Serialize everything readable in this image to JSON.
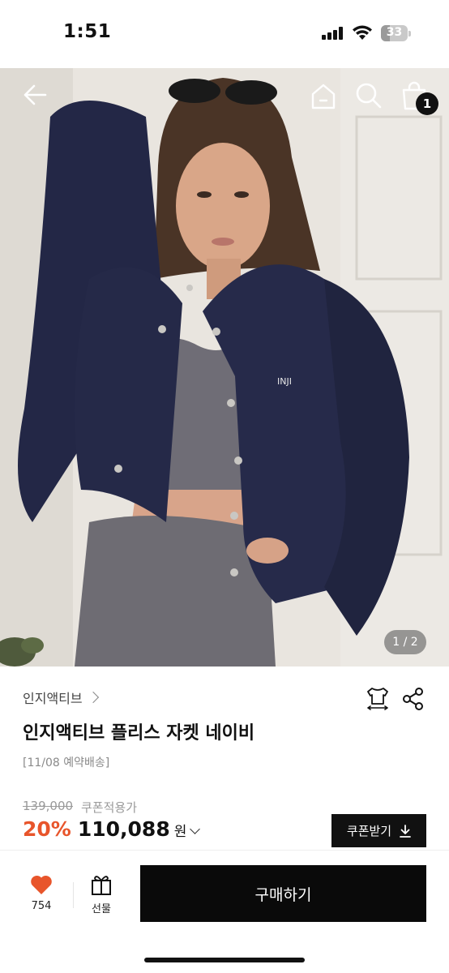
{
  "status_bar": {
    "time": "1:51",
    "battery": "33",
    "battery_level": 0.33
  },
  "gallery": {
    "page_indicator": "1 / 2",
    "cart_count": "1"
  },
  "product": {
    "brand": "인지액티브",
    "title": "인지액티브 플리스 자켓 네이비",
    "delivery_note": "[11/08 예약배송]",
    "original_price": "139,000",
    "coupon_label": "쿠폰적용가",
    "discount": "20%",
    "sale_price": "110,088",
    "currency": "원",
    "coupon_button": "쿠폰받기"
  },
  "jacket_logo": "INJI",
  "bottom_bar": {
    "like_count": "754",
    "gift_label": "선물",
    "buy_button": "구매하기"
  },
  "colors": {
    "accent_discount": "#e8552b",
    "heart": "#e8552b",
    "primary_button": "#0a0a0a"
  }
}
